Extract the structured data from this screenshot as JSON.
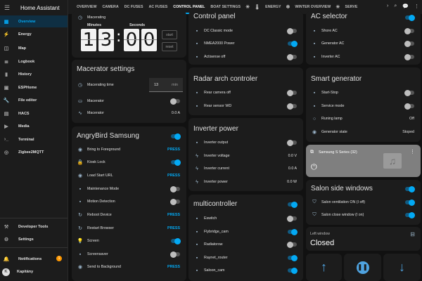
{
  "app_title": "Home Assistant",
  "sidebar": {
    "items": [
      {
        "label": "Overview",
        "icon": "overview-icon"
      },
      {
        "label": "Energy",
        "icon": "energy-icon"
      },
      {
        "label": "Map",
        "icon": "map-icon"
      },
      {
        "label": "Logbook",
        "icon": "logbook-icon"
      },
      {
        "label": "History",
        "icon": "history-icon"
      },
      {
        "label": "ESPHome",
        "icon": "esphome-icon"
      },
      {
        "label": "File editor",
        "icon": "wrench-icon"
      },
      {
        "label": "HACS",
        "icon": "hacs-icon"
      },
      {
        "label": "Media",
        "icon": "media-icon"
      },
      {
        "label": "Terminal",
        "icon": "terminal-icon"
      },
      {
        "label": "Zigbee2MQTT",
        "icon": "zigbee-icon"
      }
    ],
    "developer_tools": "Developer Tools",
    "settings": "Settings",
    "notifications": "Notifications",
    "notifications_count": "1",
    "user_name": "Kapitány",
    "user_initial": "K"
  },
  "tabs": [
    "OVERVIEW",
    "CAMERA",
    "DC FUSES",
    "AC FUSES",
    "CONTROL PANEL",
    "BOAT SETTINGS",
    "ENERGY",
    "WINTER OVERVIEW",
    "SERVE"
  ],
  "timer": {
    "status": "Macerating",
    "minutes_label": "Minutes",
    "seconds_label": "Seconds",
    "digits": [
      "1",
      "3",
      "0",
      "0"
    ],
    "start": "start",
    "reset": "reset"
  },
  "macerator": {
    "title": "Macerator settings",
    "time_label": "Macerating time",
    "time_value": "13",
    "time_unit": "min",
    "switch_label": "Macerator",
    "current_label": "Macerator",
    "current_value": "0.0 A"
  },
  "angrybird": {
    "title": "AngryBird Samsung",
    "rows": [
      {
        "label": "Bring to Foreground",
        "action": "PRESS"
      },
      {
        "label": "Kiosk Lock",
        "toggle": "on"
      },
      {
        "label": "Load Start URL",
        "action": "PRESS"
      },
      {
        "label": "Maintenance Mode",
        "toggle": "off"
      },
      {
        "label": "Motion Detection",
        "toggle": "off"
      },
      {
        "label": "Reboot Device",
        "action": "PRESS"
      },
      {
        "label": "Restart Browser",
        "action": "PRESS"
      },
      {
        "label": "Screen",
        "toggle": "on"
      },
      {
        "label": "Screensaver",
        "toggle": "off"
      },
      {
        "label": "Send to Background",
        "action": "PRESS"
      }
    ]
  },
  "control_panel": {
    "title": "Control panel",
    "rows": [
      {
        "label": "DC Classic mode",
        "toggle": "off"
      },
      {
        "label": "NMEA2000 Power",
        "toggle": "on"
      },
      {
        "label": "Actisense off",
        "toggle": "off"
      }
    ]
  },
  "radar": {
    "title": "Radar arch controler",
    "rows": [
      {
        "label": "Rear camera off",
        "toggle": "off"
      },
      {
        "label": "Rear sensor WD",
        "toggle": "off"
      }
    ]
  },
  "inverter": {
    "title": "Inverter power",
    "rows": [
      {
        "label": "Inverter output",
        "toggle": "off"
      },
      {
        "label": "Inverter voltage",
        "value": "0.0 V"
      },
      {
        "label": "Inverter current",
        "value": "0.0 A"
      },
      {
        "label": "Inverter power",
        "value": "0.0 W"
      }
    ]
  },
  "multicontroller": {
    "title": "multicontroller",
    "rows": [
      {
        "label": "Eswitch",
        "toggle": "off"
      },
      {
        "label": "Flybridge_cam",
        "toggle": "on"
      },
      {
        "label": "Radiatorsw",
        "toggle": "off"
      },
      {
        "label": "Raynet_router",
        "toggle": "on"
      },
      {
        "label": "Saloon_cam",
        "toggle": "on"
      }
    ]
  },
  "ac_selector": {
    "title": "AC selector",
    "rows": [
      {
        "label": "Shore AC",
        "toggle": "off"
      },
      {
        "label": "Generator AC",
        "toggle": "off"
      },
      {
        "label": "Inverter AC",
        "toggle": "off"
      }
    ]
  },
  "smart_generator": {
    "title": "Smart generator",
    "rows": [
      {
        "label": "Start-Stop",
        "toggle": "off"
      },
      {
        "label": "Service mode",
        "toggle": "off"
      },
      {
        "label": "Runing lamp",
        "value": "Off"
      },
      {
        "label": "Generator state",
        "value": "Stoped"
      }
    ]
  },
  "media_player": {
    "name": "Samsung S Series (32)"
  },
  "salon_windows": {
    "title": "Salon side windows",
    "rows": [
      {
        "label": "Salon ventilation ON (I off)",
        "toggle": "on"
      },
      {
        "label": "Salon close window (I on)",
        "toggle": "on"
      }
    ]
  },
  "left_window": {
    "label": "Left window",
    "state": "Closed"
  },
  "colors": {
    "accent": "#03a9f4",
    "card": "#1c1c1c",
    "background": "#111111",
    "badge": "#ff9800"
  }
}
